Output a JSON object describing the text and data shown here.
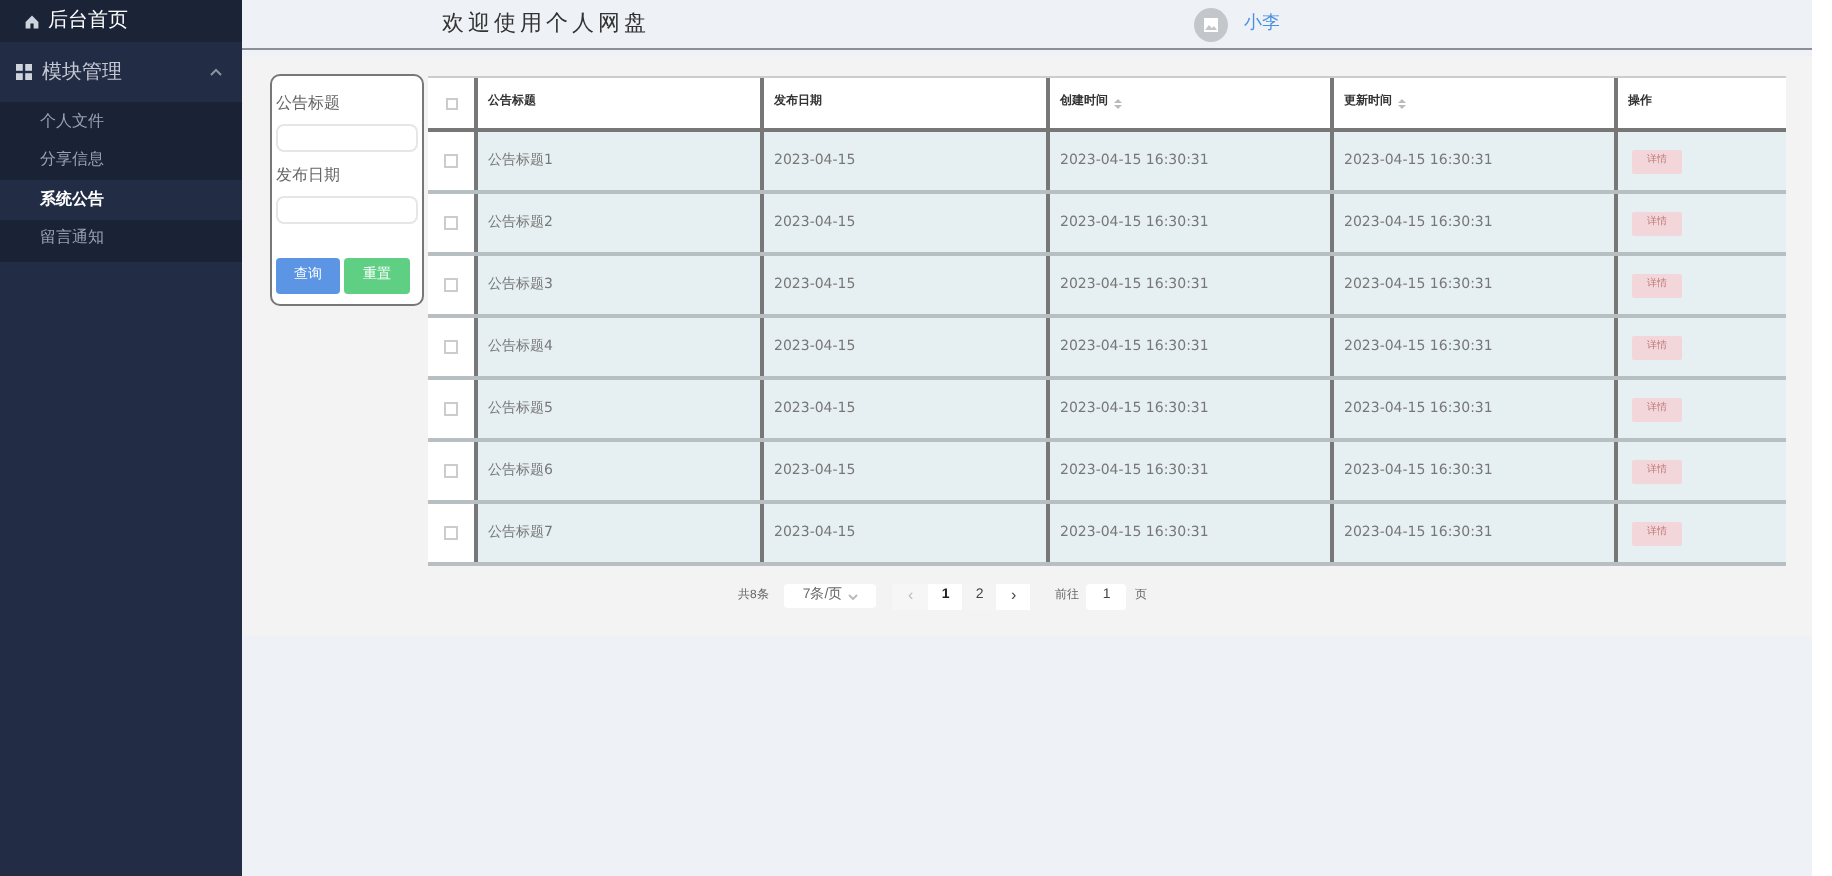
{
  "sidebar": {
    "home": {
      "label": "后台首页"
    },
    "groups": [
      {
        "label": "模块管理",
        "expanded": true,
        "items": [
          {
            "label": "个人文件",
            "selected": false
          },
          {
            "label": "分享信息",
            "selected": false
          },
          {
            "label": "系统公告",
            "selected": true
          },
          {
            "label": "留言通知",
            "selected": false
          }
        ]
      }
    ]
  },
  "header": {
    "title": "欢迎使用个人网盘",
    "user": "小李"
  },
  "filter": {
    "fields": [
      {
        "label": "公告标题"
      },
      {
        "label": "发布日期"
      }
    ],
    "buttons": [
      {
        "label": "查询",
        "kind": "primary"
      },
      {
        "label": "重置",
        "kind": "success"
      }
    ]
  },
  "table": {
    "select_all_checked": false,
    "columns": [
      {
        "label": "公告标题",
        "sortable": false
      },
      {
        "label": "发布日期",
        "sortable": false
      },
      {
        "label": "创建时间",
        "sortable": true
      },
      {
        "label": "更新时间",
        "sortable": true
      },
      {
        "label": "操作",
        "sortable": false
      }
    ],
    "rows": [
      {
        "checked": false,
        "cells": [
          "公告标题1",
          "2023-04-15",
          "2023-04-15 16:30:31",
          "2023-04-15 16:30:31"
        ],
        "action": "详情"
      },
      {
        "checked": false,
        "cells": [
          "公告标题2",
          "2023-04-15",
          "2023-04-15 16:30:31",
          "2023-04-15 16:30:31"
        ],
        "action": "详情"
      },
      {
        "checked": false,
        "cells": [
          "公告标题3",
          "2023-04-15",
          "2023-04-15 16:30:31",
          "2023-04-15 16:30:31"
        ],
        "action": "详情"
      },
      {
        "checked": false,
        "cells": [
          "公告标题4",
          "2023-04-15",
          "2023-04-15 16:30:31",
          "2023-04-15 16:30:31"
        ],
        "action": "详情"
      },
      {
        "checked": false,
        "cells": [
          "公告标题5",
          "2023-04-15",
          "2023-04-15 16:30:31",
          "2023-04-15 16:30:31"
        ],
        "action": "详情"
      },
      {
        "checked": false,
        "cells": [
          "公告标题6",
          "2023-04-15",
          "2023-04-15 16:30:31",
          "2023-04-15 16:30:31"
        ],
        "action": "详情"
      },
      {
        "checked": false,
        "cells": [
          "公告标题7",
          "2023-04-15",
          "2023-04-15 16:30:31",
          "2023-04-15 16:30:31"
        ],
        "action": "详情"
      }
    ]
  },
  "pagination": {
    "total": "共8条",
    "page_size": "7条/页",
    "prev": "‹",
    "pages": [
      {
        "label": "1",
        "selected": true
      },
      {
        "label": "2",
        "selected": false
      }
    ],
    "next": "›",
    "goto_label": "前往",
    "goto_value": "1",
    "goto_suffix": "页"
  }
}
